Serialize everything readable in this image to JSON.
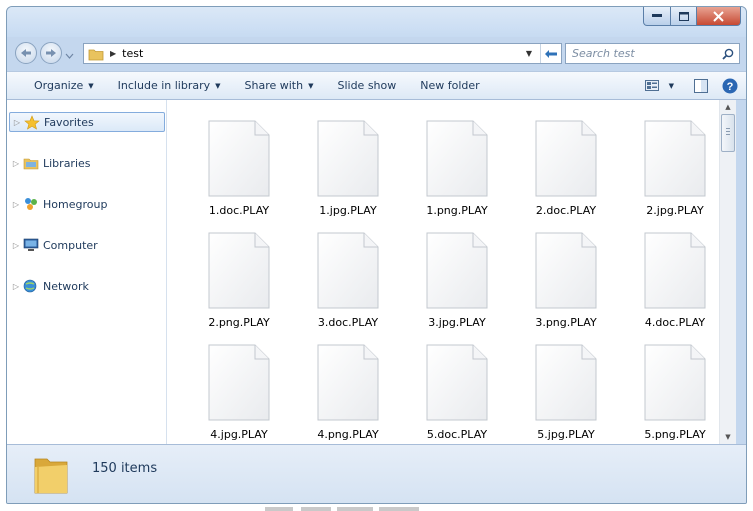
{
  "window": {
    "path_folder": "test"
  },
  "search": {
    "placeholder": "Search test"
  },
  "toolbar": {
    "organize": "Organize",
    "include_in_library": "Include in library",
    "share_with": "Share with",
    "slide_show": "Slide show",
    "new_folder": "New folder"
  },
  "nav": {
    "favorites": "Favorites",
    "libraries": "Libraries",
    "homegroup": "Homegroup",
    "computer": "Computer",
    "network": "Network"
  },
  "files": [
    "1.doc.PLAY",
    "1.jpg.PLAY",
    "1.png.PLAY",
    "2.doc.PLAY",
    "2.jpg.PLAY",
    "2.png.PLAY",
    "3.doc.PLAY",
    "3.jpg.PLAY",
    "3.png.PLAY",
    "4.doc.PLAY",
    "4.jpg.PLAY",
    "4.png.PLAY",
    "5.doc.PLAY",
    "5.jpg.PLAY",
    "5.png.PLAY"
  ],
  "status": {
    "item_count": "150 items"
  },
  "colors": {
    "accent": "#c74a33",
    "selection": "#84acdd",
    "chrome": "#c4d7ee"
  }
}
